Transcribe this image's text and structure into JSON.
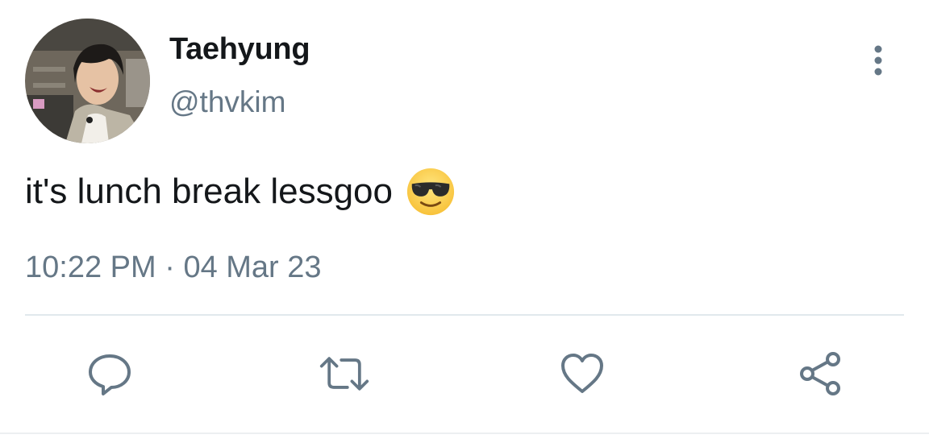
{
  "author": {
    "display_name": "Taehyung",
    "handle": "@thvkim"
  },
  "tweet": {
    "text": "it's lunch break lessgoo",
    "emoji": "smiling-face-with-sunglasses",
    "time": "10:22 PM",
    "separator": "·",
    "date": "04 Mar 23"
  },
  "icons": {
    "more": "more-vertical-icon",
    "reply": "reply-icon",
    "retweet": "retweet-icon",
    "like": "heart-icon",
    "share": "share-icon"
  },
  "colors": {
    "text": "#14171a",
    "secondary": "#657786",
    "divider": "#e1e8ed"
  }
}
